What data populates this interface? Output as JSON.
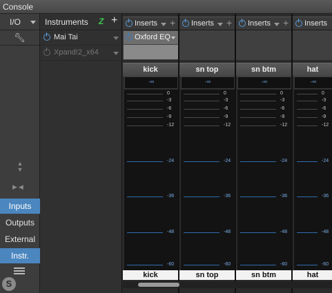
{
  "window": {
    "title": "Console"
  },
  "leftnav": {
    "io_label": "I/O",
    "buttons": [
      {
        "label": "Inputs",
        "active": true
      },
      {
        "label": "Outputs",
        "active": false
      },
      {
        "label": "External",
        "active": false
      },
      {
        "label": "Instr.",
        "active": true
      }
    ]
  },
  "instruments": {
    "title": "Instruments",
    "items": [
      {
        "name": "Mai Tai",
        "enabled": true
      },
      {
        "name": "Xpand!2_x64",
        "enabled": false
      }
    ]
  },
  "channels": [
    {
      "name": "kick",
      "inserts_label": "Inserts",
      "plugin": "Oxford EQ",
      "peak": "-∞",
      "bottom_name": "kick"
    },
    {
      "name": "sn top",
      "inserts_label": "Inserts",
      "plugin": "",
      "peak": "-∞",
      "bottom_name": "sn top"
    },
    {
      "name": "sn btm",
      "inserts_label": "Inserts",
      "plugin": "",
      "peak": "-∞",
      "bottom_name": "sn btm"
    },
    {
      "name": "hat",
      "inserts_label": "Inserts",
      "plugin": "",
      "peak": "-∞",
      "bottom_name": "hat"
    }
  ],
  "meter_scale": [
    "0",
    "-3",
    "-6",
    "-9",
    "-12",
    "-24",
    "-36",
    "-48",
    "-60"
  ],
  "colors": {
    "accent": "#4b86bf",
    "meter_tick": "#2f6db0",
    "power_on": "#5a9ad6"
  }
}
